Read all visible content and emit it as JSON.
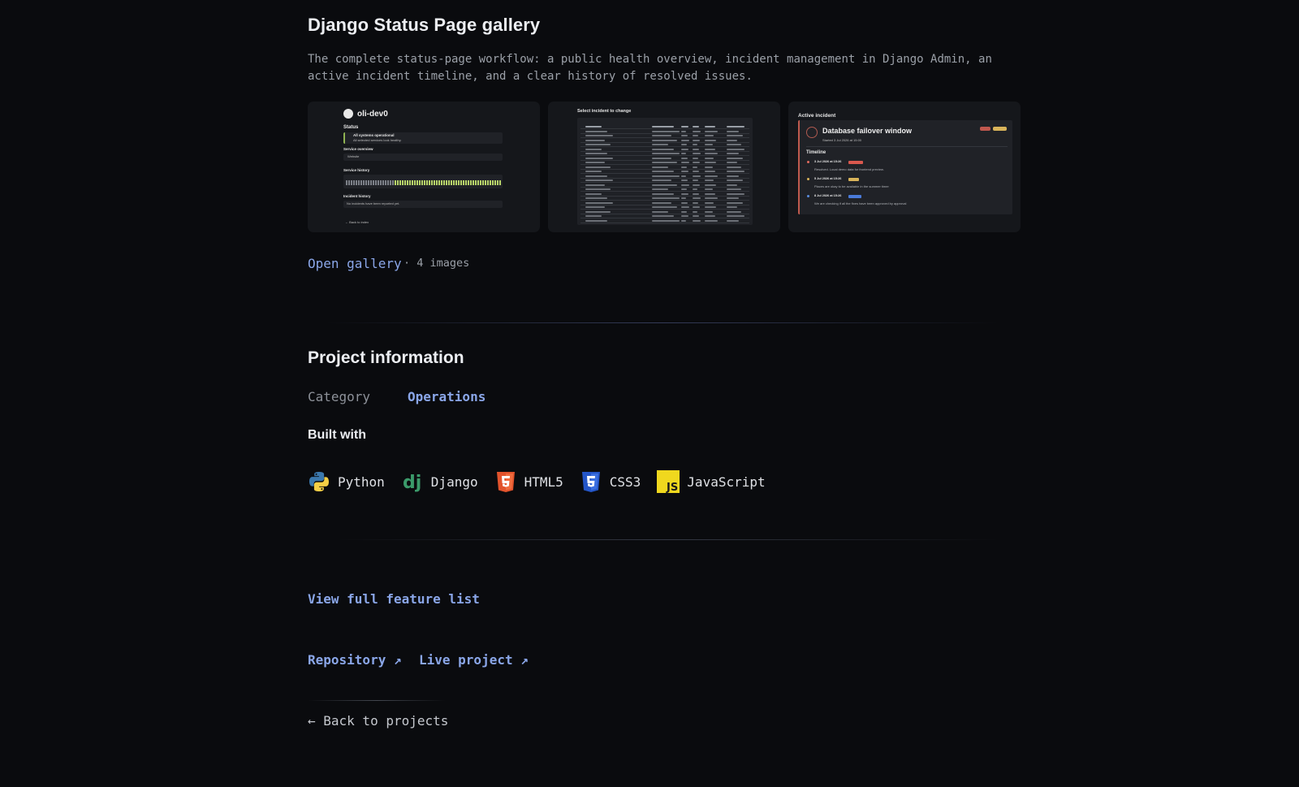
{
  "gallery": {
    "title": "Django Status Page gallery",
    "description": "The complete status-page workflow: a public health overview, incident management in Django Admin, an active incident timeline, and a clear history of resolved issues.",
    "open_label": "Open gallery",
    "count_label": "· 4 images",
    "thumb1": {
      "brand": "oli-dev0",
      "status_label": "Status",
      "status_text": "All systems operational",
      "status_sub": "All selected services look healthy.",
      "overview_label": "Service overview",
      "service_name": "Website",
      "history_label": "Service history",
      "incident_label": "Incident history",
      "incident_empty": "No incidents have been reported yet.",
      "back": "← Back to index"
    },
    "thumb2": {
      "title": "Select incident to change"
    },
    "thumb3": {
      "section": "Active incident",
      "incident_title": "Database failover window",
      "started": "Started 3 Jul 2026 at 15:00",
      "timeline_label": "Timeline",
      "entries": [
        {
          "time": "3 Jul 2026 at 15:26",
          "text": "Resolved. Local demo data for frontend preview."
        },
        {
          "time": "5 Jul 2026 at 15:26",
          "text": "Places are okay to be available in the summer timer"
        },
        {
          "time": "8 Jul 2026 at 15:26",
          "text": "We are checking if all the fixes have been approved by approval"
        }
      ]
    }
  },
  "project": {
    "title": "Project information",
    "category_label": "Category",
    "category_value": "Operations",
    "built_with_label": "Built with",
    "tech": [
      {
        "name": "Python",
        "icon": "python-icon"
      },
      {
        "name": "Django",
        "icon": "django-icon"
      },
      {
        "name": "HTML5",
        "icon": "html5-icon"
      },
      {
        "name": "CSS3",
        "icon": "css3-icon"
      },
      {
        "name": "JavaScript",
        "icon": "javascript-icon"
      }
    ]
  },
  "links": {
    "feature_list": "View full feature list",
    "repository": "Repository ↗",
    "live_project": "Live project ↗",
    "back": "← Back to projects"
  },
  "colors": {
    "background": "#0a0b0e",
    "accent": "#8aa6e8",
    "muted": "#9ba0a8"
  }
}
